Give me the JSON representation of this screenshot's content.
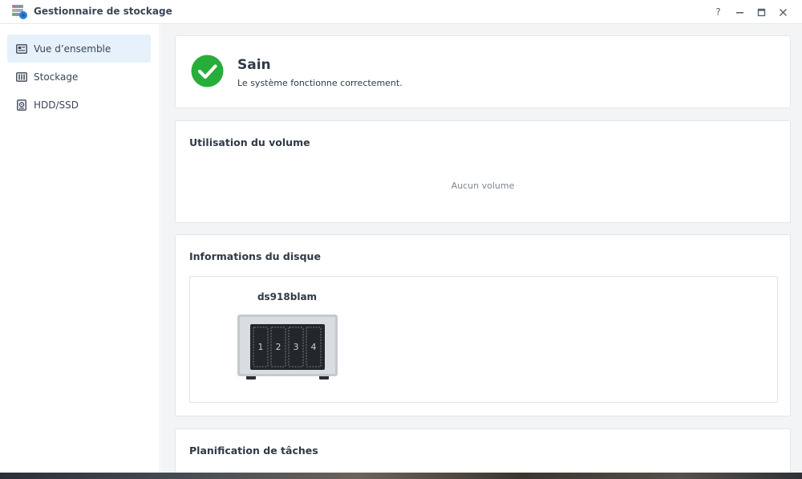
{
  "window": {
    "title": "Gestionnaire de stockage",
    "controls": {
      "help": "?",
      "minimize": "—",
      "maximize": "□",
      "close": "✕"
    }
  },
  "sidebar": {
    "items": [
      {
        "label": "Vue d’ensemble",
        "icon": "overview-icon",
        "active": true
      },
      {
        "label": "Stockage",
        "icon": "storage-icon",
        "active": false
      },
      {
        "label": "HDD/SSD",
        "icon": "hdd-icon",
        "active": false
      }
    ]
  },
  "status": {
    "title": "Sain",
    "description": "Le système fonctionne correctement.",
    "icon": "check-circle-icon",
    "color": "#27ae3a"
  },
  "volume_usage": {
    "title": "Utilisation du volume",
    "empty_text": "Aucun volume"
  },
  "disk_info": {
    "title": "Informations du disque",
    "device_name": "ds918blam",
    "bays": [
      "1",
      "2",
      "3",
      "4"
    ]
  },
  "task_planning": {
    "title": "Planification de tâches"
  },
  "colors": {
    "accent": "#e6f1fb",
    "background": "#f2f4f6",
    "success": "#27ae3a"
  }
}
